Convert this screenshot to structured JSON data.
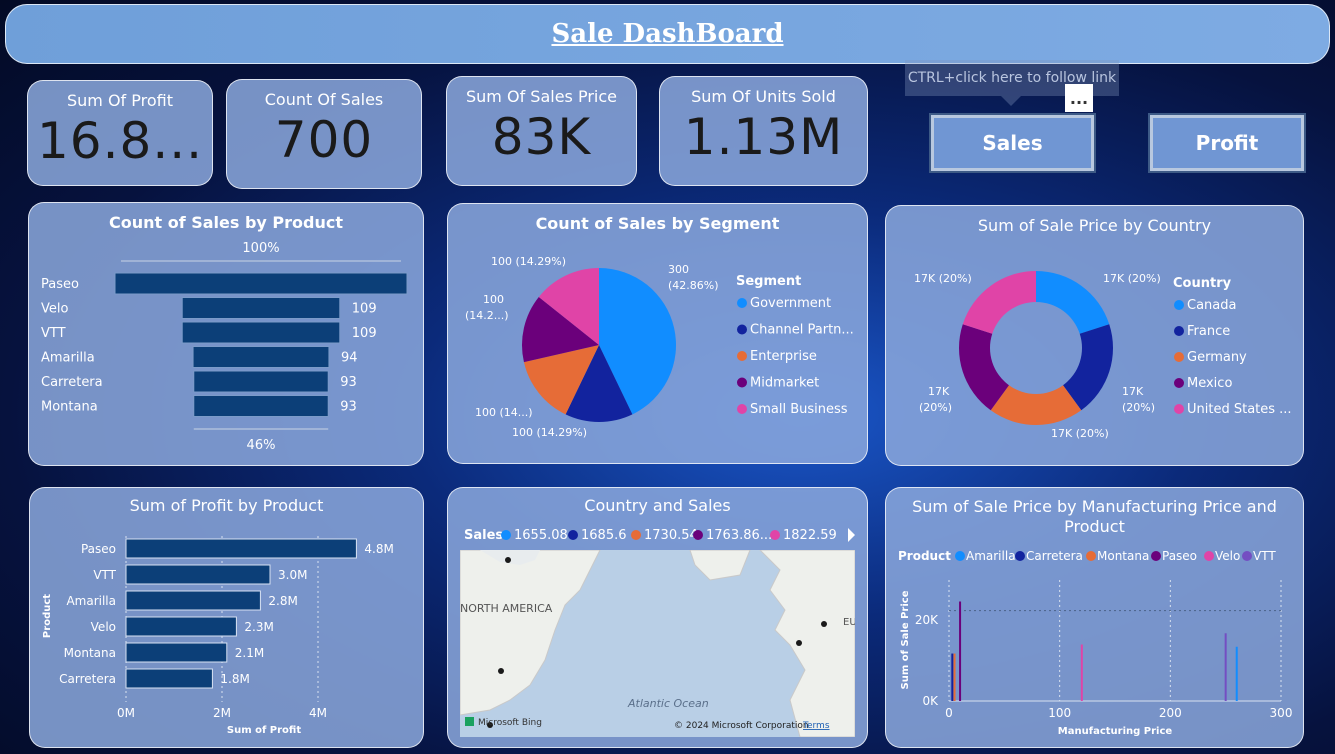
{
  "header": {
    "title": "Sale DashBoard"
  },
  "kpis": [
    {
      "label": "Sum Of Profit",
      "value": "16.8..."
    },
    {
      "label": "Count Of Sales",
      "value": "700"
    },
    {
      "label": "Sum Of Sales Price",
      "value": "83K"
    },
    {
      "label": "Sum Of Units Sold",
      "value": "1.13M"
    }
  ],
  "nav": {
    "sales_label": "Sales",
    "profit_label": "Profit",
    "tooltip": "CTRL+click here to follow link",
    "more_label": "..."
  },
  "colors": {
    "blue": "#118DFF",
    "navy": "#12239E",
    "orange": "#E66C37",
    "purple": "#6B007B",
    "pink": "#E044A7",
    "violet": "#744EC2",
    "bar": "#0c3f78"
  },
  "funnel": {
    "title": "Count of Sales by Product",
    "top_label": "100%",
    "bottom_label": "46%",
    "categories": [
      "Paseo",
      "Velo",
      "VTT",
      "Amarilla",
      "Carretera",
      "Montana"
    ],
    "values": [
      202,
      109,
      109,
      94,
      93,
      93
    ],
    "value_labels": [
      "",
      "109",
      "109",
      "94",
      "93",
      "93"
    ]
  },
  "segment_pie": {
    "title": "Count of Sales by Segment",
    "legend_title": "Segment",
    "legend": [
      "Government",
      "Channel Partn...",
      "Enterprise",
      "Midmarket",
      "Small Business"
    ],
    "values": [
      300,
      100,
      100,
      100,
      100
    ],
    "labels": [
      "300",
      "(42.86%)",
      "100 (14.29%)",
      "100 (14...)",
      "100",
      "(14.2...)",
      "100 (14.29%)"
    ]
  },
  "country_donut": {
    "title": "Sum of Sale Price by Country",
    "legend_title": "Country",
    "legend": [
      "Canada",
      "France",
      "Germany",
      "Mexico",
      "United States ..."
    ],
    "values": [
      20,
      20,
      20,
      20,
      20
    ],
    "labels": [
      "17K (20%)",
      "17K",
      "(20%)",
      "17K (20%)",
      "17K",
      "(20%)",
      "17K (20%)"
    ]
  },
  "chart_data": [
    {
      "type": "bar",
      "title": "Count of Sales by Product",
      "categories": [
        "Paseo",
        "Velo",
        "VTT",
        "Amarilla",
        "Carretera",
        "Montana"
      ],
      "values": [
        202,
        109,
        109,
        94,
        93,
        93
      ]
    },
    {
      "type": "pie",
      "title": "Count of Sales by Segment",
      "categories": [
        "Government",
        "Channel Partn...",
        "Enterprise",
        "Midmarket",
        "Small Business"
      ],
      "values": [
        300,
        100,
        100,
        100,
        100
      ]
    },
    {
      "type": "pie",
      "title": "Sum of Sale Price by Country",
      "categories": [
        "Canada",
        "France",
        "Germany",
        "Mexico",
        "United States ..."
      ],
      "values": [
        17000,
        17000,
        17000,
        17000,
        17000
      ]
    },
    {
      "type": "bar",
      "title": "Sum of Profit by Product",
      "categories": [
        "Paseo",
        "VTT",
        "Amarilla",
        "Velo",
        "Montana",
        "Carretera"
      ],
      "values": [
        4.8,
        3.0,
        2.8,
        2.3,
        2.1,
        1.8
      ],
      "value_labels": [
        "4.8M",
        "3.0M",
        "2.8M",
        "2.3M",
        "2.1M",
        "1.8M"
      ],
      "xlabel": "Sum of Profit",
      "ylabel": "Product",
      "xticks": [
        "0M",
        "2M",
        "4M"
      ],
      "xlim": [
        0,
        5
      ]
    },
    {
      "type": "scatter",
      "title": "Sum of Sale Price by Manufacturing Price and Product",
      "legend_title": "Product",
      "series": [
        {
          "name": "Amarilla",
          "x": [
            260
          ],
          "y": [
            12000
          ]
        },
        {
          "name": "Carretera",
          "x": [
            3
          ],
          "y": [
            10500
          ]
        },
        {
          "name": "Montana",
          "x": [
            5
          ],
          "y": [
            10500
          ]
        },
        {
          "name": "Paseo",
          "x": [
            10
          ],
          "y": [
            22000
          ]
        },
        {
          "name": "Velo",
          "x": [
            120
          ],
          "y": [
            12500
          ]
        },
        {
          "name": "VTT",
          "x": [
            250
          ],
          "y": [
            15000
          ]
        }
      ],
      "xlabel": "Manufacturing Price",
      "ylabel": "Sum of Sale Price",
      "xticks": [
        "0",
        "100",
        "200",
        "300"
      ],
      "yticks": [
        "0K",
        "20K"
      ],
      "xlim": [
        0,
        300
      ],
      "ylim": [
        0,
        25000
      ]
    }
  ],
  "profit_bar": {
    "title": "Sum of Profit by Product",
    "xlabel": "Sum of Profit",
    "ylabel": "Product",
    "categories": [
      "Paseo",
      "VTT",
      "Amarilla",
      "Velo",
      "Montana",
      "Carretera"
    ],
    "values": [
      4.8,
      3.0,
      2.8,
      2.3,
      2.1,
      1.8
    ],
    "value_labels": [
      "4.8M",
      "3.0M",
      "2.8M",
      "2.3M",
      "2.1M",
      "1.8M"
    ],
    "xticks": [
      "0M",
      "2M",
      "4M"
    ]
  },
  "map": {
    "title": "Country and Sales",
    "legend_title": "Sales",
    "legend": [
      "1655.08",
      "1685.6",
      "1730.54",
      "1763.86...",
      "1822.59"
    ],
    "labels": {
      "north_america": "NORTH AMERICA",
      "ocean": "Atlantic Ocean",
      "eu": "EU"
    },
    "footer": {
      "bing": "Microsoft Bing",
      "copyright": "© 2024 Microsoft Corporation",
      "terms": "Terms"
    }
  },
  "scatter": {
    "title": "Sum of Sale Price by Manufacturing Price and Product",
    "legend_title": "Product",
    "legend": [
      "Amarilla",
      "Carretera",
      "Montana",
      "Paseo",
      "Velo",
      "VTT"
    ],
    "xlabel": "Manufacturing Price",
    "ylabel": "Sum of Sale Price",
    "xticks": [
      "0",
      "100",
      "200",
      "300"
    ],
    "yticks": [
      "0K",
      "20K"
    ]
  }
}
